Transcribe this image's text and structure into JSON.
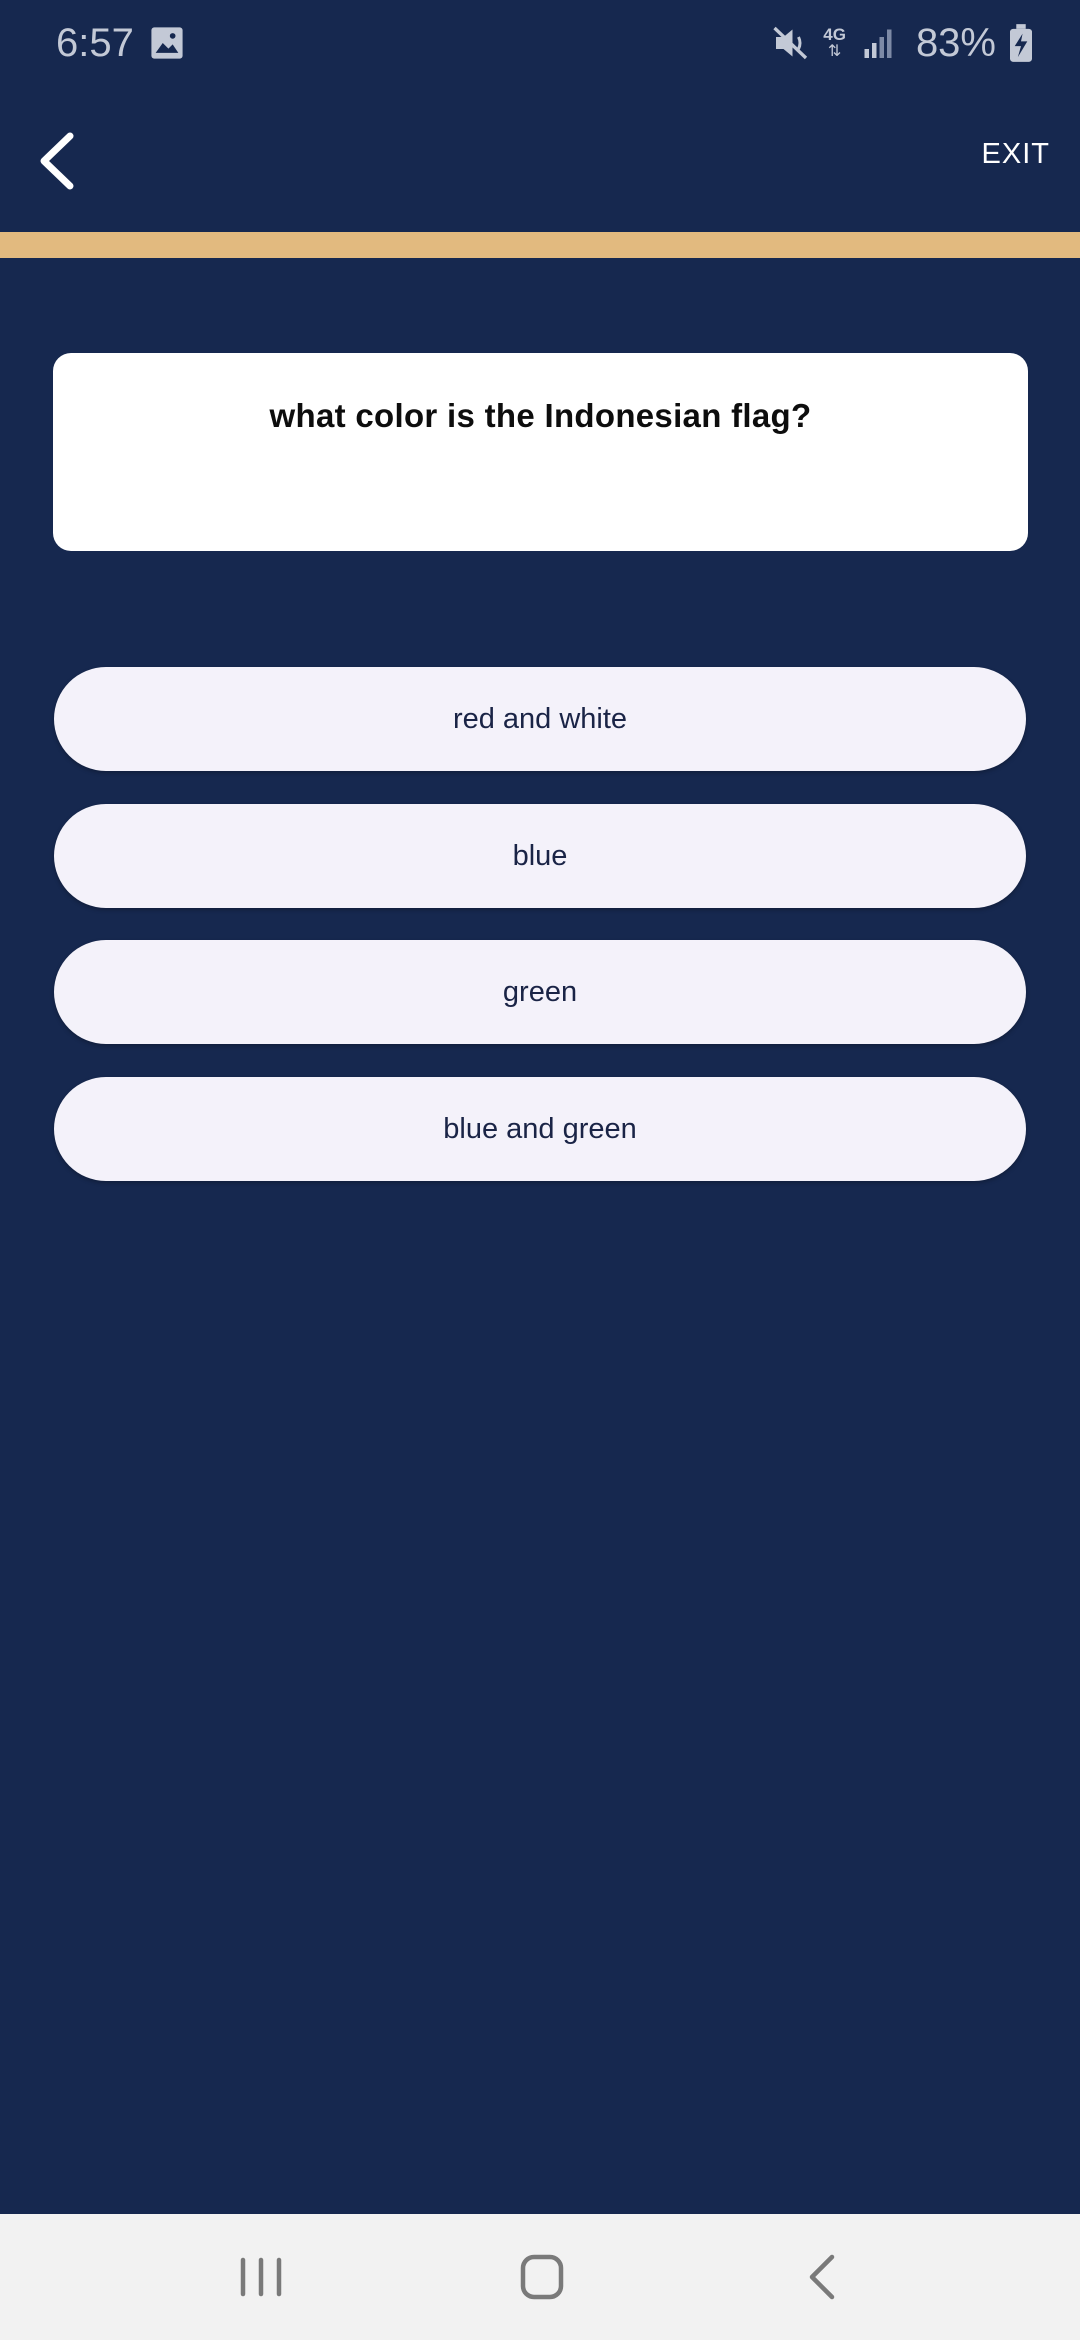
{
  "status_bar": {
    "time": "6:57",
    "network": "4G",
    "battery_percent": "83%",
    "icons": [
      "gallery-icon",
      "mute-icon",
      "network-4g-icon",
      "signal-icon",
      "battery-charging-icon"
    ]
  },
  "top_bar": {
    "exit_label": "EXIT",
    "back_icon": "chevron-left-icon"
  },
  "progress": {
    "value": 1.0,
    "color": "#e2ba7f"
  },
  "question": {
    "text": "what color is the Indonesian flag?"
  },
  "answers": [
    {
      "label": "red and white"
    },
    {
      "label": "blue"
    },
    {
      "label": "green"
    },
    {
      "label": "blue and green"
    }
  ],
  "colors": {
    "background": "#16284f",
    "card": "#ffffff",
    "answer_bg": "#f4f2fa",
    "answer_text": "#1a2446",
    "accent": "#e2ba7f"
  },
  "nav_bar": {
    "icons": [
      "recent-apps-icon",
      "home-icon",
      "back-icon"
    ]
  }
}
